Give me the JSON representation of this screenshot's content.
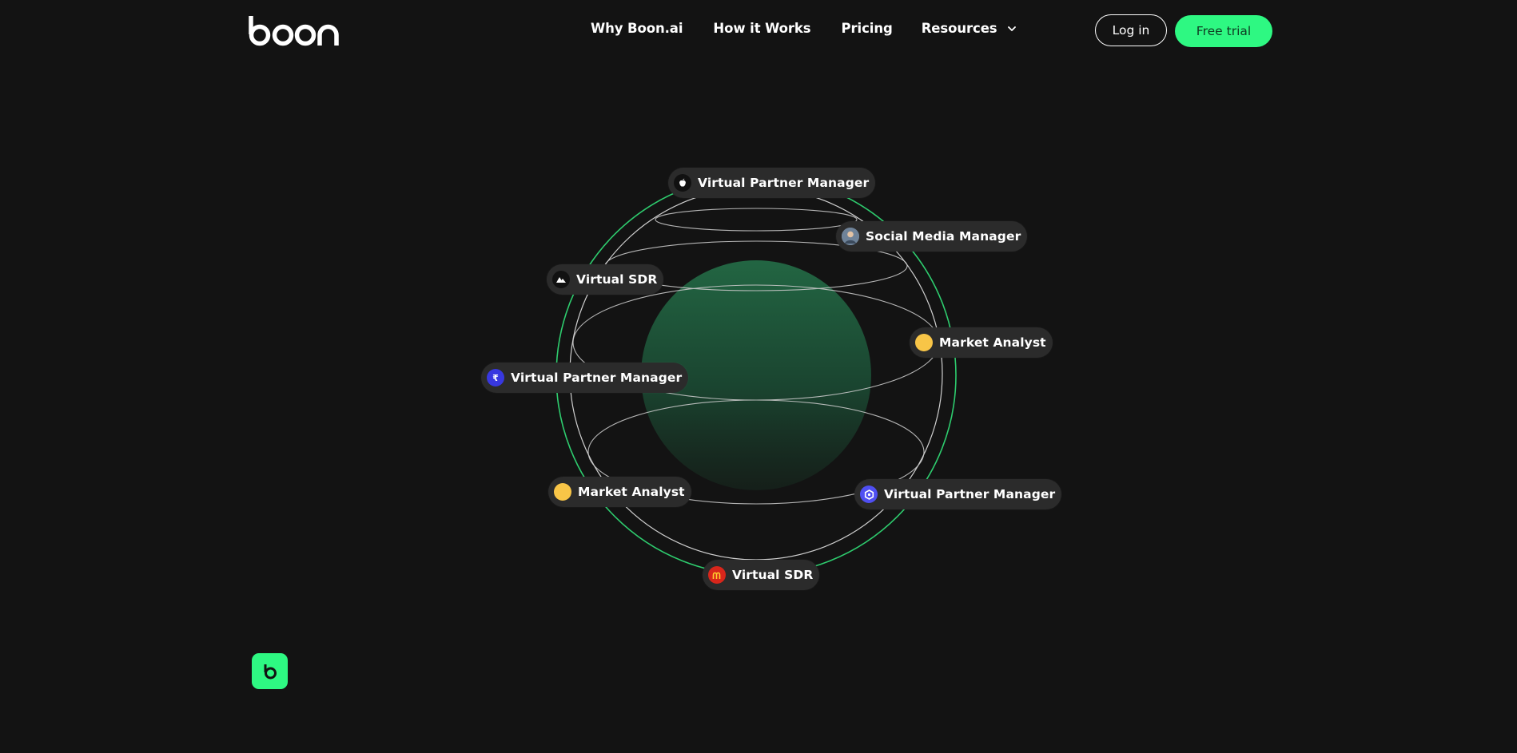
{
  "brand": {
    "logo_text": "boon",
    "accent_color": "#2ef882",
    "background_color": "#131313"
  },
  "nav": {
    "items": [
      {
        "label": "Why Boon.ai"
      },
      {
        "label": "How it Works"
      },
      {
        "label": "Pricing"
      },
      {
        "label": "Resources",
        "icon": "chevron-down-icon"
      }
    ]
  },
  "header": {
    "login_label": "Log in",
    "trial_label": "Free trial"
  },
  "roles": [
    {
      "label": "Virtual Partner Manager",
      "icon": "apple-icon"
    },
    {
      "label": "Social Media Manager",
      "icon": "avatar-photo-icon"
    },
    {
      "label": "Virtual SDR",
      "icon": "mountain-logo-icon"
    },
    {
      "label": "Market Analyst",
      "icon": "yellow-dot-icon"
    },
    {
      "label": "Virtual Partner Manager",
      "icon": "rupee-icon"
    },
    {
      "label": "Market Analyst",
      "icon": "yellow-dot-icon"
    },
    {
      "label": "Virtual Partner Manager",
      "icon": "hexagon-logo-icon"
    },
    {
      "label": "Virtual SDR",
      "icon": "mcdonalds-logo-icon"
    }
  ],
  "chat": {
    "icon": "boon-chat-icon"
  }
}
